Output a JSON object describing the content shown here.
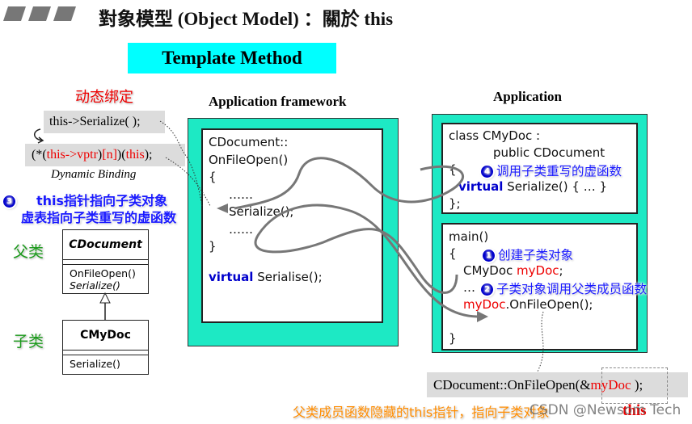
{
  "header": {
    "title": "對象模型 (Object Model) ：關於 this",
    "subtitle": "Template Method"
  },
  "left": {
    "dynamic_label": "动态绑定",
    "call_line": "this->Serialize( );",
    "expansion": {
      "p1": "(*(",
      "this1": "this",
      "arrow": "->",
      "vptr": "vptr",
      ")": ")",
      "idx": "[n]",
      "p2": ")(",
      "this2": "this",
      "end": ");"
    },
    "caption": "Dynamic Binding",
    "note3_num": "3",
    "note3_this": "this",
    "note3_line1": "指针指向子类对象",
    "note3_line2": "虚表指向子类重写的虚函数",
    "parent_label": "父类",
    "child_label": "子类",
    "uml_parent": {
      "name": "CDocument",
      "method1": "OnFileOpen()",
      "method2": "Serialize()"
    },
    "uml_child": {
      "name": "CMyDoc",
      "method1": "Serialize()"
    }
  },
  "framework": {
    "title": "Application framework",
    "lines": [
      "CDocument::",
      "OnFileOpen()",
      "{",
      "……",
      "Serialize();",
      "……",
      "}"
    ],
    "virtual_kw": "virtual",
    "virtual_rest": " Serialise();"
  },
  "application": {
    "title": "Application",
    "class_lines": [
      "class CMyDoc :",
      "public CDocument",
      "{",
      "};"
    ],
    "virtual_kw": "virtual",
    "virtual_rest": " Serialize() { … }",
    "note4_num": "4",
    "note4": "调用子类重写的虚函数",
    "main_lines": [
      "main()",
      "{",
      "}"
    ],
    "note1_num": "1",
    "note1": "创建子类对象",
    "decl_type": "CMyDoc ",
    "decl_var": "myDoc",
    "decl_end": ";",
    "ellipsis": "…",
    "note2_num": "2",
    "note2": "子类对象调用父类成员函数",
    "call_var": "myDoc",
    "call_rest": ".OnFileOpen();"
  },
  "bottom": {
    "call_pre": "CDocument::OnFileOpen(&",
    "call_var": "myDoc",
    "call_end": " );",
    "this_label": "this",
    "note": "父类成员函数隐藏的this指针，指向子类对象",
    "watermark": "CSDN @Newsom Tech"
  },
  "colors": {
    "teal": "#1de9c4",
    "cyan": "#00ffff",
    "blue": "#1a1aff",
    "red": "#e00000",
    "orange": "#ff8c00",
    "green": "#1a9a1a"
  }
}
